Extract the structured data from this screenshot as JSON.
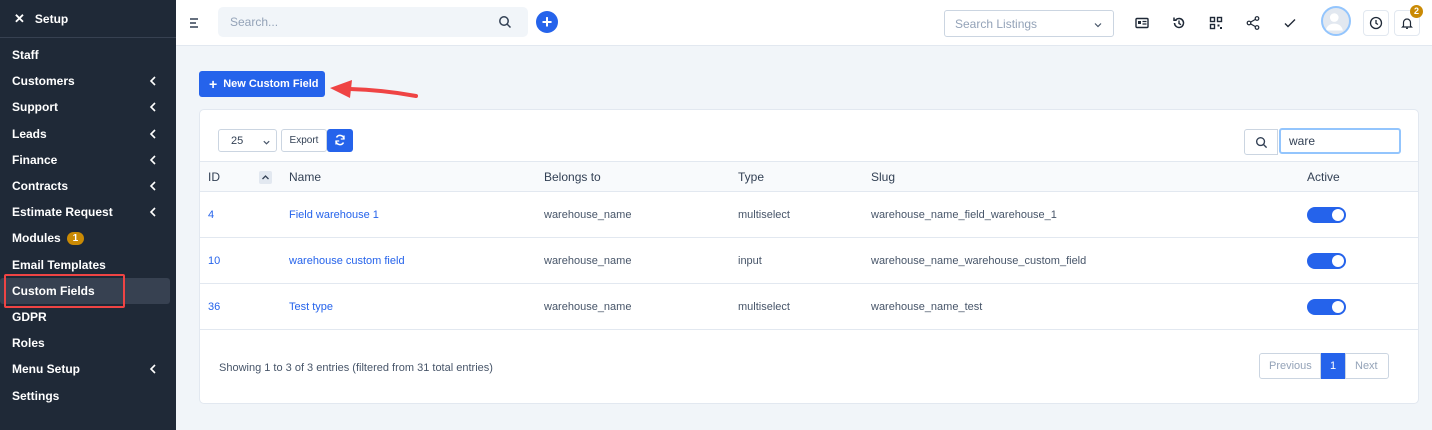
{
  "sidebar": {
    "header": "Setup",
    "items": [
      {
        "label": "Staff",
        "has_chevron": false
      },
      {
        "label": "Customers",
        "has_chevron": true
      },
      {
        "label": "Support",
        "has_chevron": true
      },
      {
        "label": "Leads",
        "has_chevron": true
      },
      {
        "label": "Finance",
        "has_chevron": true
      },
      {
        "label": "Contracts",
        "has_chevron": true
      },
      {
        "label": "Estimate Request",
        "has_chevron": true
      },
      {
        "label": "Modules",
        "badge": "1",
        "has_chevron": false
      },
      {
        "label": "Email Templates",
        "has_chevron": false
      },
      {
        "label": "Custom Fields",
        "has_chevron": false,
        "active": true
      },
      {
        "label": "GDPR",
        "has_chevron": false
      },
      {
        "label": "Roles",
        "has_chevron": false
      },
      {
        "label": "Menu Setup",
        "has_chevron": true
      },
      {
        "label": "Settings",
        "has_chevron": false
      }
    ]
  },
  "topbar": {
    "search_placeholder": "Search...",
    "listings_placeholder": "Search Listings",
    "notification_count": "2",
    "icons": [
      "menu-icon",
      "search-icon",
      "plus-icon",
      "id-card-icon",
      "history-icon",
      "qr-code-icon",
      "share-icon",
      "check-icon",
      "avatar",
      "clock-icon",
      "bell-icon"
    ]
  },
  "main": {
    "new_button_label": "New Custom Field",
    "length_value": "25",
    "export_label": "Export",
    "filter_value": "ware",
    "columns": [
      "ID",
      "Name",
      "Belongs to",
      "Type",
      "Slug",
      "Active"
    ],
    "rows": [
      {
        "id": "4",
        "name": "Field warehouse 1",
        "belongs_to": "warehouse_name",
        "type": "multiselect",
        "slug": "warehouse_name_field_warehouse_1",
        "active": true
      },
      {
        "id": "10",
        "name": "warehouse custom field",
        "belongs_to": "warehouse_name",
        "type": "input",
        "slug": "warehouse_name_warehouse_custom_field",
        "active": true
      },
      {
        "id": "36",
        "name": "Test type",
        "belongs_to": "warehouse_name",
        "type": "multiselect",
        "slug": "warehouse_name_test",
        "active": true
      }
    ],
    "info_text": "Showing 1 to 3 of 3 entries (filtered from 31 total entries)",
    "pagination": {
      "previous": "Previous",
      "current": "1",
      "next": "Next"
    }
  },
  "colors": {
    "accent": "#2563eb",
    "sidebar_bg": "#1f2937",
    "highlight": "#ef4444",
    "badge": "#ca8a04"
  }
}
